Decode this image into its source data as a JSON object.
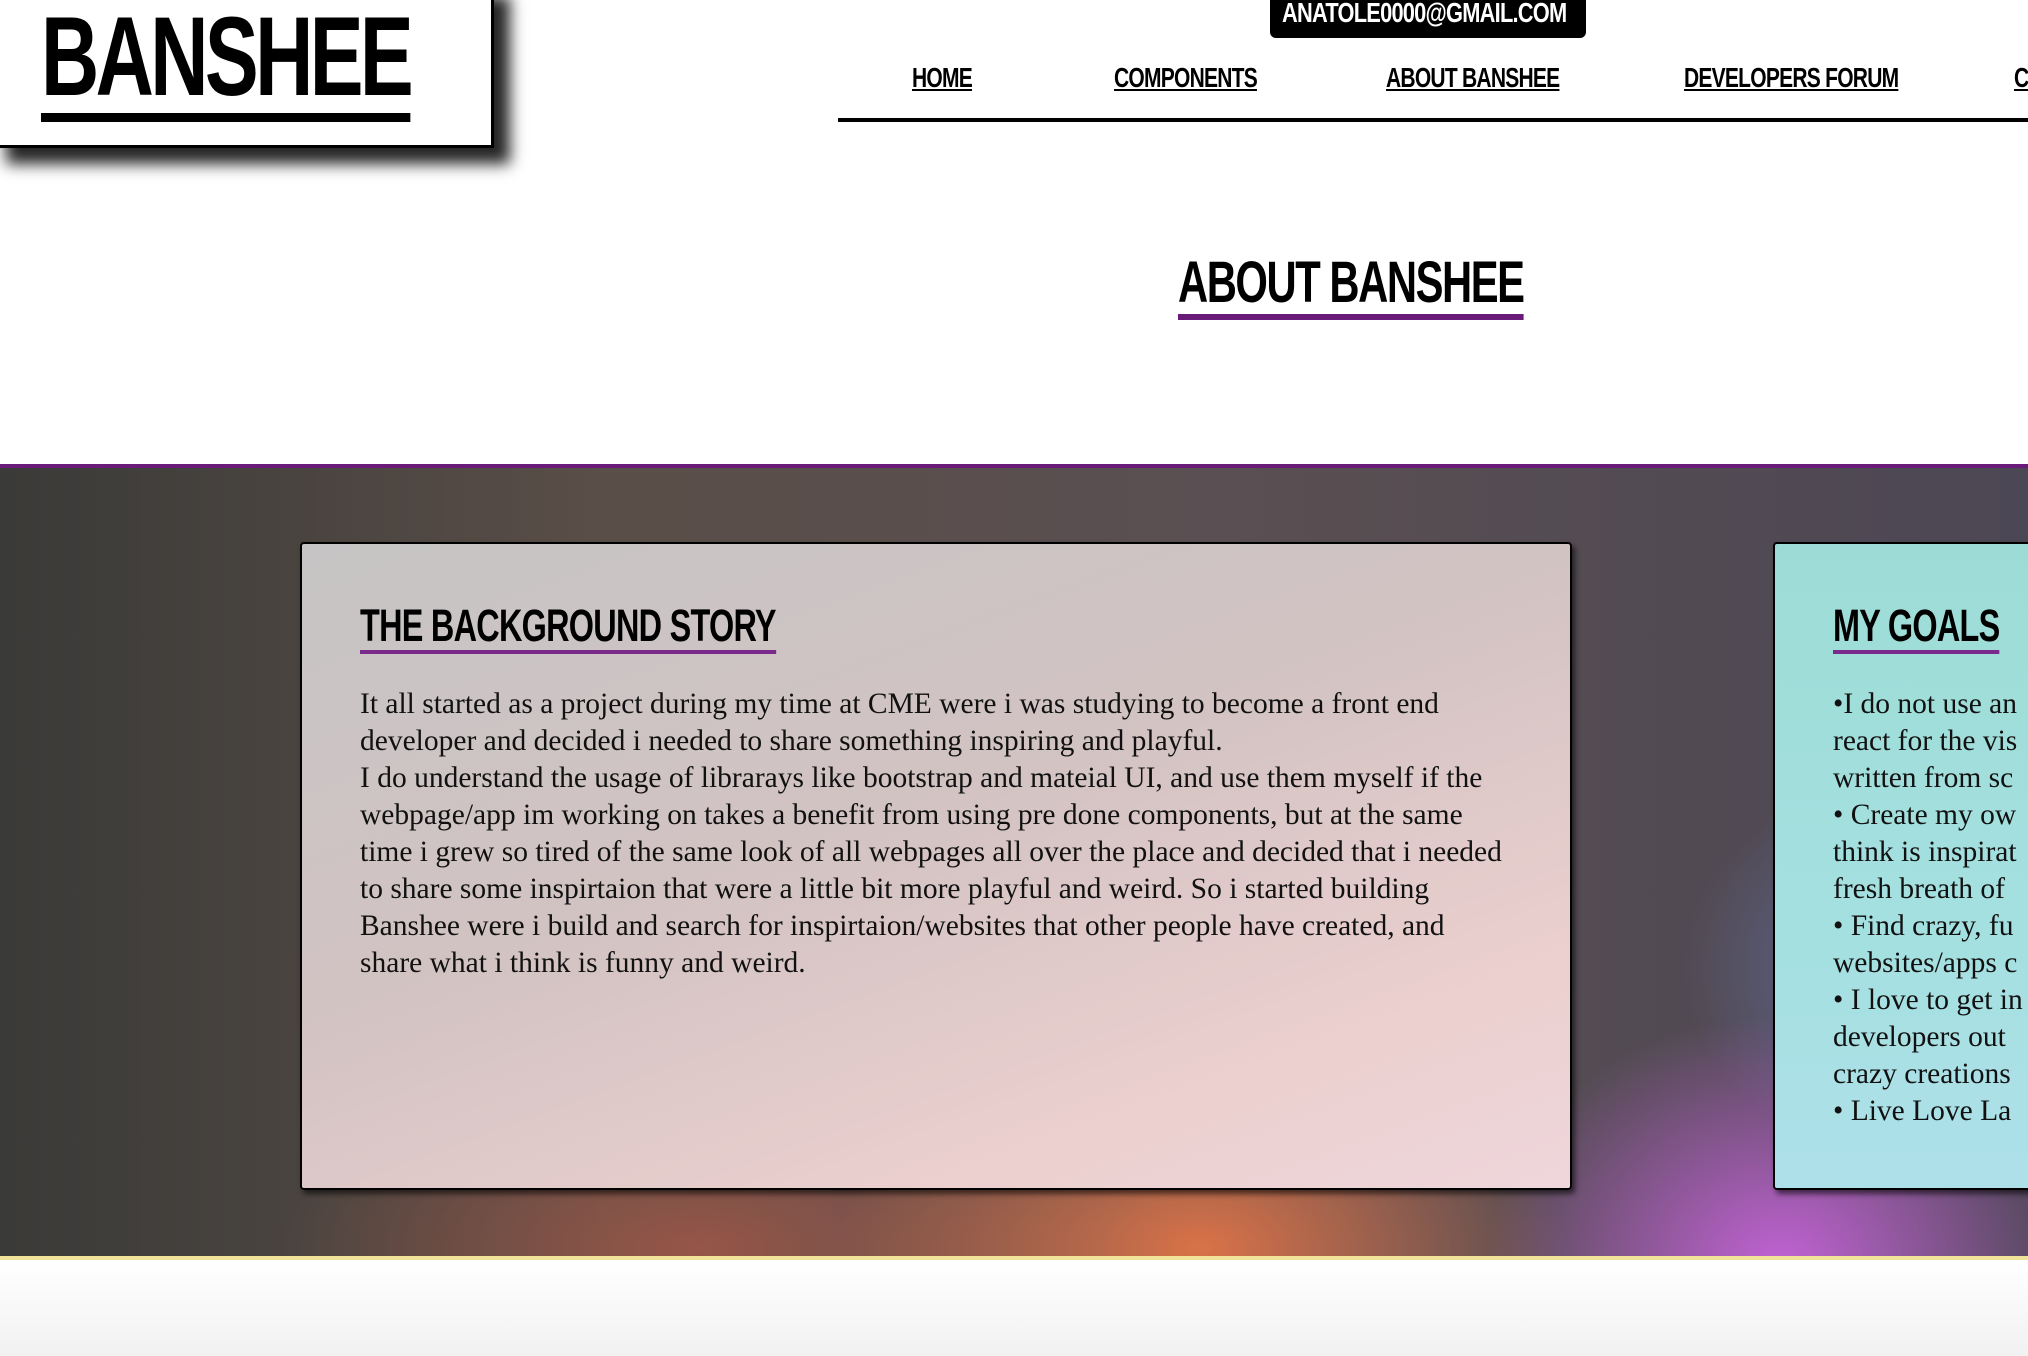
{
  "header": {
    "logo": "BANSHEE",
    "email": "anatole0000@gmail.com"
  },
  "nav": {
    "items": [
      {
        "label": "HOME"
      },
      {
        "label": "COMPONENTS"
      },
      {
        "label": "ABOUT BANSHEE"
      },
      {
        "label": "DEVELOPERS FORUM"
      },
      {
        "label": "C"
      }
    ]
  },
  "main": {
    "page_title": "ABOUT BANSHEE",
    "story": {
      "title": "THE BACKGROUND STORY",
      "paragraph_1": "It all started as a project during my time at CME were i was studying to become a front end developer and decided i needed to share something inspiring and playful.",
      "paragraph_2": "I do understand the usage of librarays like bootstrap and mateial UI, and use them myself if the webpage/app im working on takes a benefit from using pre done components, but at the same time i grew so tired of the same look of all webpages all over the place and decided that i needed to share some inspirtaion that were a little bit more playful and weird. So i started building Banshee were i build and search for inspirtaion/websites that other people have created, and share what i think is funny and weird."
    },
    "goals": {
      "title": "MY GOALS",
      "lines": [
        "•I do not use an",
        "react for the vis",
        "written from sc",
        "• Create my ow",
        "think is inspirat",
        "fresh breath of",
        "• Find crazy, fu",
        "websites/apps c",
        "• I love to get in",
        "developers out",
        "crazy creations",
        "• Live Love La"
      ]
    }
  },
  "colors": {
    "accent_purple": "#6a1b7a",
    "goals_card": "#a4e0e0",
    "story_card": "#d3c3c3"
  }
}
